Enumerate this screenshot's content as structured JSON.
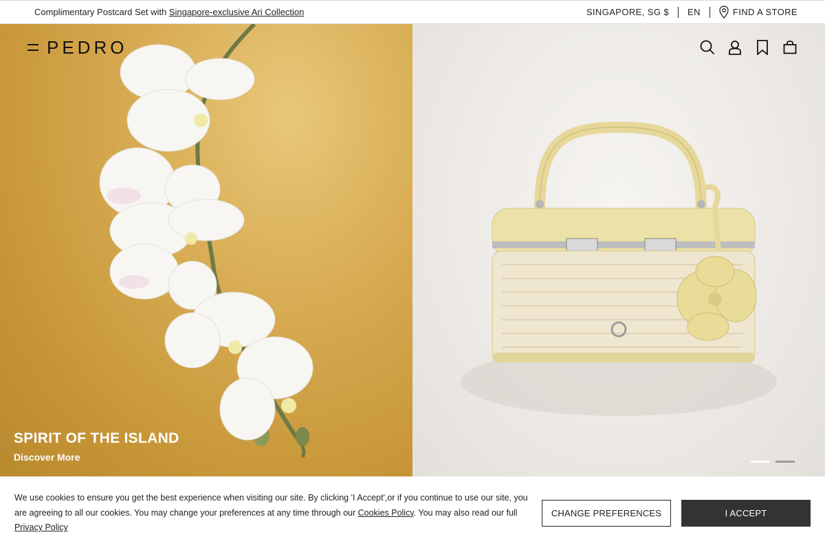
{
  "promo": {
    "text": "Complimentary Postcard Set with ",
    "link": "Singapore-exclusive Ari Collection",
    "region": "SINGAPORE, SG $",
    "language": "EN",
    "store_locator": "FIND A STORE"
  },
  "header": {
    "logo": "PEDRO",
    "icons": [
      "menu-icon",
      "search-icon",
      "account-icon",
      "wishlist-icon",
      "bag-icon"
    ]
  },
  "hero": {
    "title": "SPIRIT OF THE ISLAND",
    "cta": "Discover More",
    "slides_total": 2,
    "active_slide": 1
  },
  "cookie": {
    "text_part1": "We use cookies to ensure you get the best experience when visiting our site. By clicking 'I Accept',or if you continue to use our site, you are agreeing to all our cookies. You may change your preferences at any time through our ",
    "cookies_link": "Cookies Policy",
    "text_part2": ". You may also read our full ",
    "privacy_link": "Privacy Policy",
    "change_label": "CHANGE PREFERENCES",
    "accept_label": "I ACCEPT"
  },
  "colors": {
    "gold_backdrop": "#c69536",
    "bag_yellow": "#e6d89a",
    "accept_button": "#333333"
  }
}
